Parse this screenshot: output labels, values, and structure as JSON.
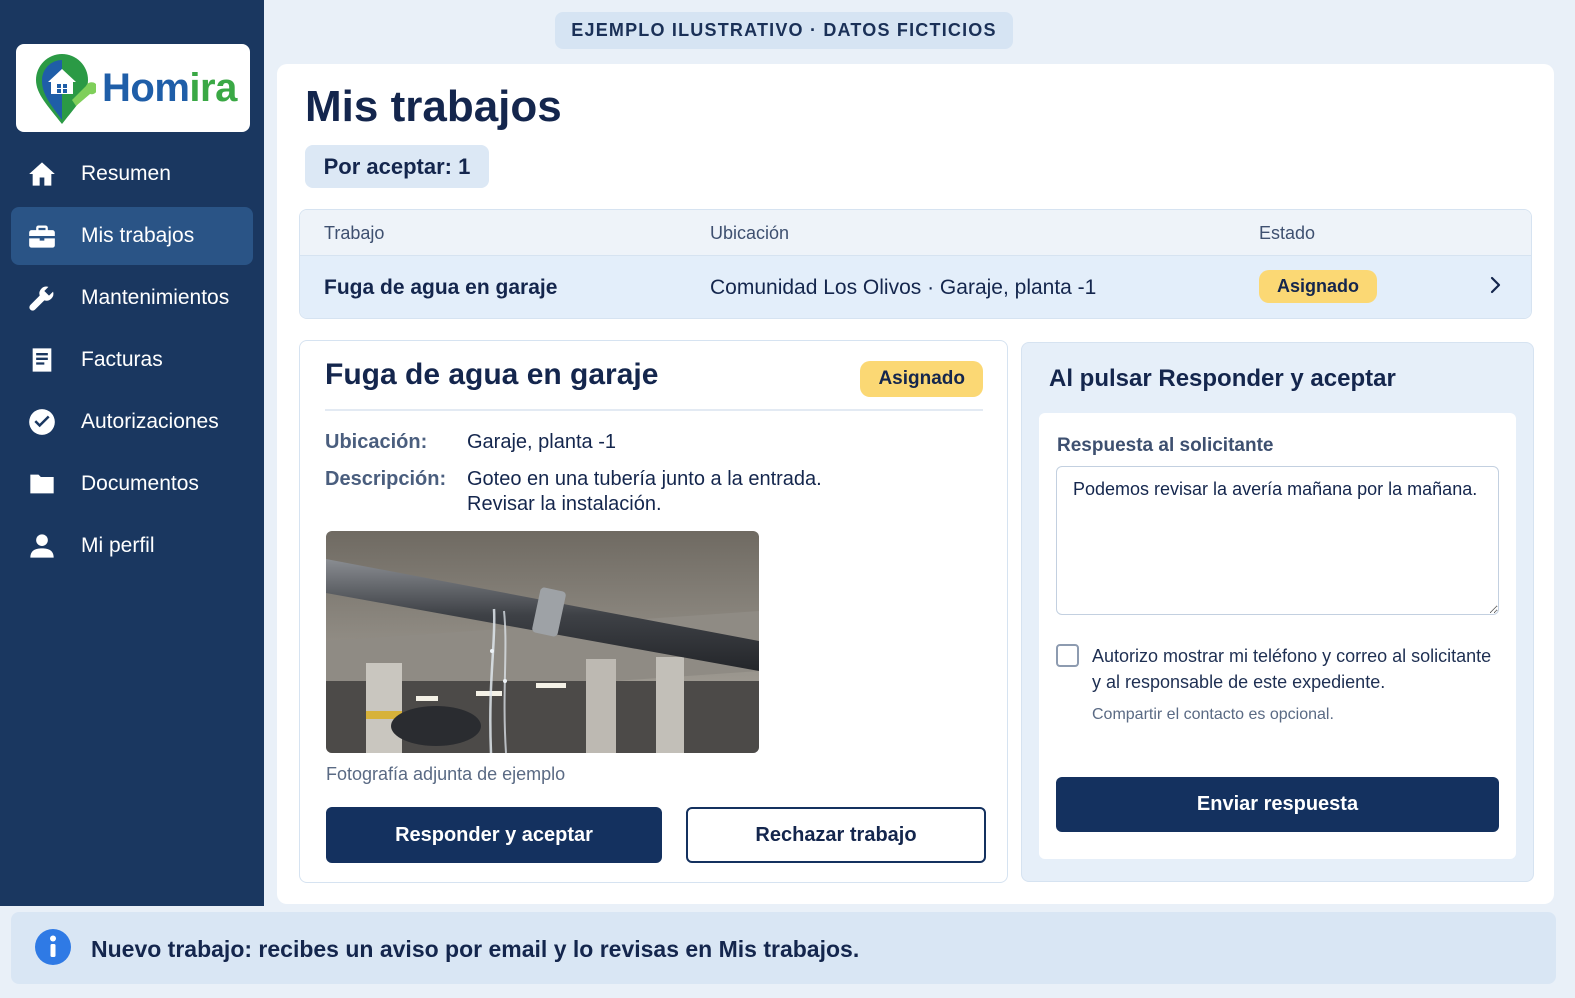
{
  "brand": {
    "name_part1": "Hom",
    "name_part2": "ira"
  },
  "banner": "EJEMPLO ILUSTRATIVO · DATOS FICTICIOS",
  "sidebar": {
    "items": [
      {
        "label": "Resumen",
        "icon": "home-icon"
      },
      {
        "label": "Mis trabajos",
        "icon": "briefcase-icon",
        "active": true
      },
      {
        "label": "Mantenimientos",
        "icon": "wrench-icon"
      },
      {
        "label": "Facturas",
        "icon": "document-icon"
      },
      {
        "label": "Autorizaciones",
        "icon": "check-circle-icon"
      },
      {
        "label": "Documentos",
        "icon": "folder-icon"
      },
      {
        "label": "Mi perfil",
        "icon": "user-icon"
      }
    ]
  },
  "page": {
    "title": "Mis trabajos",
    "pending": "Por aceptar: 1"
  },
  "table": {
    "headers": [
      "Trabajo",
      "Ubicación",
      "Estado"
    ],
    "rows": [
      {
        "job": "Fuga de agua en garaje",
        "location": "Comunidad Los Olivos · Garaje, planta -1",
        "status": "Asignado"
      }
    ]
  },
  "detail": {
    "title": "Fuga de agua en garaje",
    "status": "Asignado",
    "location_label": "Ubicación:",
    "location_value": "Garaje, planta -1",
    "description_label": "Descripción:",
    "description_line1": "Goteo en una tubería junto a la entrada.",
    "description_line2": "Revisar la instalación.",
    "photo_caption": "Fotografía adjunta de ejemplo",
    "accept_button": "Responder y aceptar",
    "reject_button": "Rechazar trabajo"
  },
  "response": {
    "title": "Al pulsar Responder y aceptar",
    "field_label": "Respuesta al solicitante",
    "message": "Podemos revisar la avería mañana por la mañana.",
    "consent_text": "Autorizo mostrar mi teléfono y correo al solicitante y al responsable de este expediente.",
    "hint": "Compartir el contacto es opcional.",
    "consent_checked": false,
    "send_button": "Enviar respuesta"
  },
  "info": {
    "text": "Nuevo trabajo: recibes un aviso por email y lo revisas en Mis trabajos."
  },
  "colors": {
    "sidebar": "#1a3760",
    "primary": "#14315f",
    "badge": "#fbd874",
    "info_icon": "#2f7ae5"
  }
}
